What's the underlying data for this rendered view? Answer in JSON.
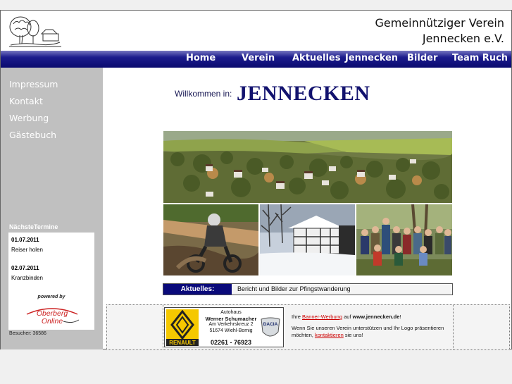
{
  "header": {
    "title_line1": "Gemeinnütziger Verein",
    "title_line2": "Jennecken e.V."
  },
  "nav": {
    "items": [
      "Home",
      "Verein",
      "Aktuelles",
      "Jennecken",
      "Bilder",
      "Team Ruch"
    ]
  },
  "sidebar": {
    "links": [
      "Impressum",
      "Kontakt",
      "Werbung",
      "Gästebuch"
    ],
    "termine_title": "NächsteTermine",
    "termine": [
      {
        "date": "01.07.2011",
        "text": "Reiser holen"
      },
      {
        "date": "02.07.2011",
        "text": "Kranzbinden"
      }
    ],
    "powered_by": "powered by",
    "powered_logo_line1": "Oberberg",
    "powered_logo_line2": "Online",
    "visitors": "Besucher: 36586"
  },
  "main": {
    "welcome_small": "Willkommen in:",
    "welcome_big": "JENNECKEN"
  },
  "news": {
    "label": "Aktuelles:",
    "text": "Bericht und Bilder zur Pfingstwanderung"
  },
  "ad": {
    "line1": "Autohaus",
    "line2": "Werner Schumacher",
    "line3": "Am Verkehrskreuz 2",
    "line4": "51674 Wiehl-Bomig",
    "phone": "02261 - 76923",
    "renault_label": "RENAULT",
    "dacia_label": "DACIA"
  },
  "promo": {
    "p1_a": "Ihre ",
    "p1_link": "Banner-Werbung",
    "p1_b": " auf ",
    "p1_site": "www.jennecken.de",
    "p1_c": "!",
    "p2_a": "Wenn Sie unseren Verein unterstützen und Ihr Logo präsentieren möchten, ",
    "p2_link": "kontaktieren",
    "p2_b": " sie uns!"
  }
}
